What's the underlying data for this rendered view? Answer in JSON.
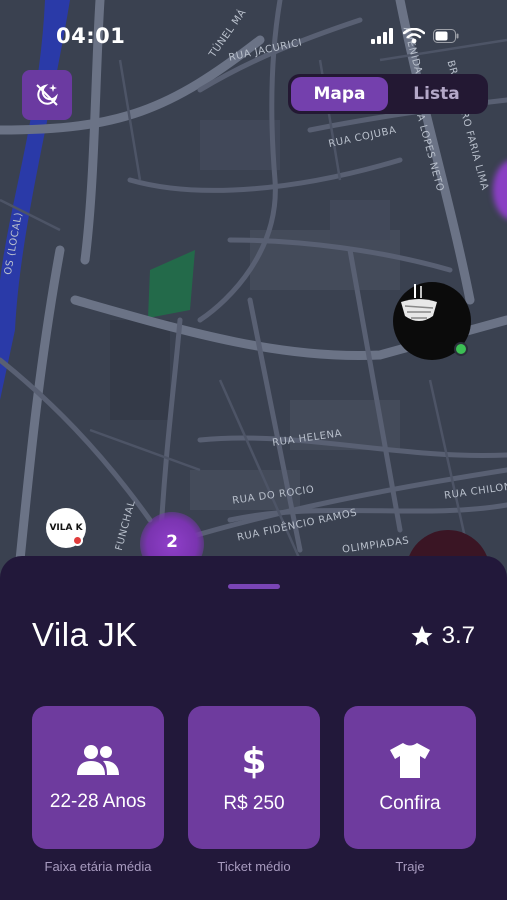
{
  "status_bar": {
    "time": "04:01"
  },
  "segment": {
    "map_label": "Mapa",
    "list_label": "Lista",
    "selected": "Mapa"
  },
  "map": {
    "streets": [
      {
        "key": "tunel",
        "text": "TÚNEL MÁ"
      },
      {
        "key": "jacurici",
        "text": "RUA JACURICI"
      },
      {
        "key": "cojuba",
        "text": "RUA COJUBA"
      },
      {
        "key": "lopes_neto",
        "text": "RUA LOPES NETO"
      },
      {
        "key": "avenida",
        "text": "AVENIDA"
      },
      {
        "key": "faria_lima",
        "text": "BRIGADEIRO FARIA LIMA"
      },
      {
        "key": "local",
        "text": "OS (LOCAL)"
      },
      {
        "key": "helena",
        "text": "RUA HELENA"
      },
      {
        "key": "funchal",
        "text": "FUNCHAL"
      },
      {
        "key": "rocio",
        "text": "RUA DO ROCIO"
      },
      {
        "key": "fidencio",
        "text": "RUA FIDÊNCIO RAMOS"
      },
      {
        "key": "chilon",
        "text": "RUA CHILON"
      },
      {
        "key": "olimpiadas",
        "text": "OLIMPIADAS"
      }
    ],
    "cluster_count": "2",
    "vila_marker_text": "VILA K",
    "online_color": "#3cbf55"
  },
  "venue": {
    "name": "Vila JK",
    "rating": "3.7",
    "stats": [
      {
        "icon": "people-icon",
        "value": "22-28 Anos",
        "caption": "Faixa etária média"
      },
      {
        "icon": "dollar-icon",
        "value": "R$ 250",
        "caption": "Ticket médio"
      },
      {
        "icon": "tshirt-icon",
        "value": "Confira",
        "caption": "Traje"
      }
    ]
  },
  "colors": {
    "accent": "#7440ad",
    "sheet": "#22183a",
    "card": "#6e3b9e",
    "map_bg": "#3a4150"
  }
}
